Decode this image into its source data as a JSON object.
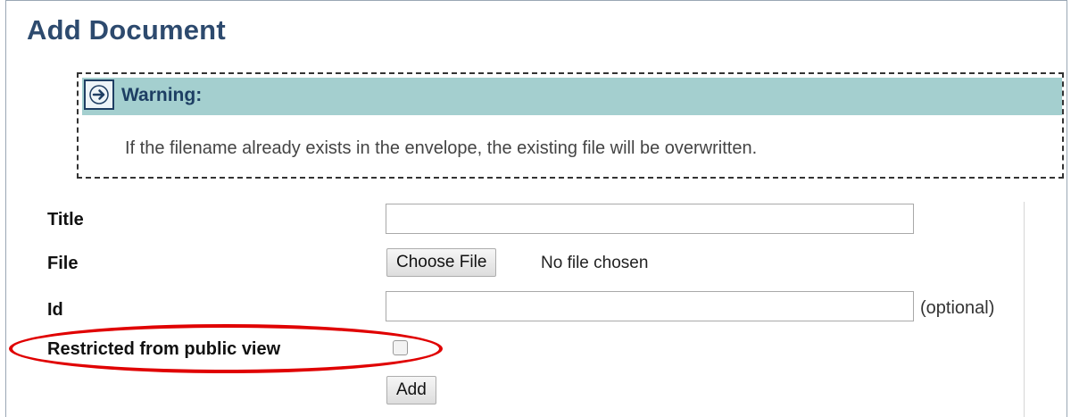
{
  "page": {
    "title": "Add Document"
  },
  "warning": {
    "title": "Warning:",
    "message": "If the filename already exists in the envelope, the existing file will be overwritten.",
    "icon": "arrow-right-icon"
  },
  "form": {
    "title_label": "Title",
    "title_value": "",
    "file_label": "File",
    "choose_file_label": "Choose File",
    "no_file_text": "No file chosen",
    "id_label": "Id",
    "id_value": "",
    "id_hint": "(optional)",
    "restricted_label": "Restricted from public view",
    "restricted_checked": false,
    "add_label": "Add"
  },
  "colors": {
    "title": "#2d4a6e",
    "warning_bar": "#a4cfcf",
    "highlight_oval": "#e00000"
  }
}
